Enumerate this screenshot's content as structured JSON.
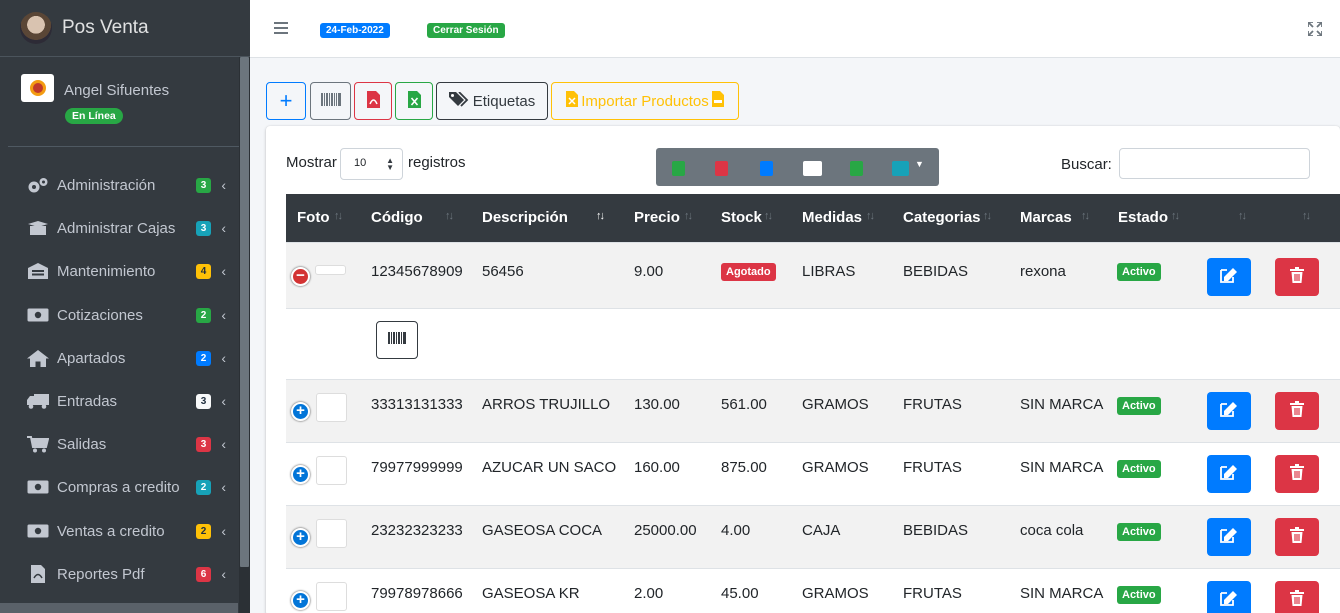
{
  "brand": {
    "title": "Pos Venta"
  },
  "user": {
    "name": "Angel Sifuentes",
    "status": "En Línea"
  },
  "sidebar": {
    "items": [
      {
        "label": "Administración",
        "badge": "3",
        "icon": "gears-icon"
      },
      {
        "label": "Administrar Cajas",
        "badge": "3",
        "icon": "box-open-icon"
      },
      {
        "label": "Mantenimiento",
        "badge": "4",
        "icon": "warehouse-icon"
      },
      {
        "label": "Cotizaciones",
        "badge": "2",
        "icon": "money-bill-icon"
      },
      {
        "label": "Apartados",
        "badge": "2",
        "icon": "home-icon"
      },
      {
        "label": "Entradas",
        "badge": "3",
        "icon": "truck-icon"
      },
      {
        "label": "Salidas",
        "badge": "3",
        "icon": "cart-icon"
      },
      {
        "label": "Compras a credito",
        "badge": "2",
        "icon": "money-bill-icon"
      },
      {
        "label": "Ventas a credito",
        "badge": "2",
        "icon": "money-bill-icon"
      },
      {
        "label": "Reportes Pdf",
        "badge": "6",
        "icon": "file-pdf-icon"
      }
    ]
  },
  "topbar": {
    "date": "24-Feb-2022",
    "logout": "Cerrar Sesión"
  },
  "toolbar": {
    "add": "+",
    "tags_label": "Etiquetas",
    "import_label": "Importar Productos"
  },
  "table_controls": {
    "show_label": "Mostrar",
    "page_size": "10",
    "records_label": "registros",
    "search_label": "Buscar:",
    "search_value": ""
  },
  "columns": [
    "Foto",
    "Código",
    "Descripción",
    "Precio",
    "Stock",
    "Medidas",
    "Categorias",
    "Marcas",
    "Estado"
  ],
  "rows": [
    {
      "code": "12345678909",
      "desc": "56456",
      "price": "9.00",
      "stock": "Agotado",
      "measure": "LIBRAS",
      "category": "BEBIDAS",
      "brand": "rexona",
      "status": "Activo"
    },
    {
      "code": "33313131333",
      "desc": "ARROS TRUJILLO",
      "price": "130.00",
      "stock": "561.00",
      "measure": "GRAMOS",
      "category": "FRUTAS",
      "brand": "SIN MARCA",
      "status": "Activo"
    },
    {
      "code": "79977999999",
      "desc": "AZUCAR UN SACO",
      "price": "160.00",
      "stock": "875.00",
      "measure": "GRAMOS",
      "category": "FRUTAS",
      "brand": "SIN MARCA",
      "status": "Activo"
    },
    {
      "code": "23232323233",
      "desc": "GASEOSA COCA",
      "price": "25000.00",
      "stock": "4.00",
      "measure": "CAJA",
      "category": "BEBIDAS",
      "brand": "coca cola",
      "status": "Activo"
    },
    {
      "code": "79978978666",
      "desc": "GASEOSA KR",
      "price": "2.00",
      "stock": "45.00",
      "measure": "GRAMOS",
      "category": "FRUTAS",
      "brand": "SIN MARCA",
      "status": "Activo"
    }
  ]
}
